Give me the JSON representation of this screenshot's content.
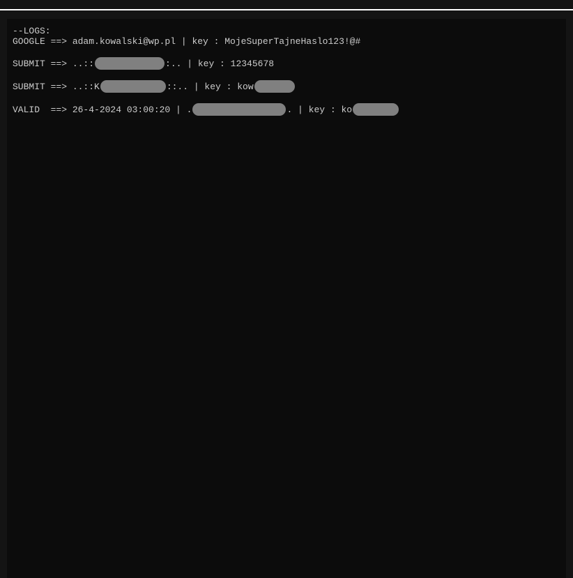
{
  "logs": {
    "header": "--LOGS:",
    "line1": "GOOGLE ==> adam.kowalski@wp.pl | key : MojeSuperTajneHaslo123!@#",
    "line2": {
      "part1": "SUBMIT ==> ..::",
      "redact1_width": 100,
      "part2": ":.. | key : 12345678"
    },
    "line3": {
      "part1": "SUBMIT ==> ..::K",
      "redact1_width": 94,
      "part2": "::.. | key : kow",
      "redact2_width": 58
    },
    "line4": {
      "part1": "VALID  ==> 26-4-2024 03:00:20 | .",
      "redact1_width": 134,
      "part2": ". | key : ko",
      "redact2_width": 66
    }
  }
}
